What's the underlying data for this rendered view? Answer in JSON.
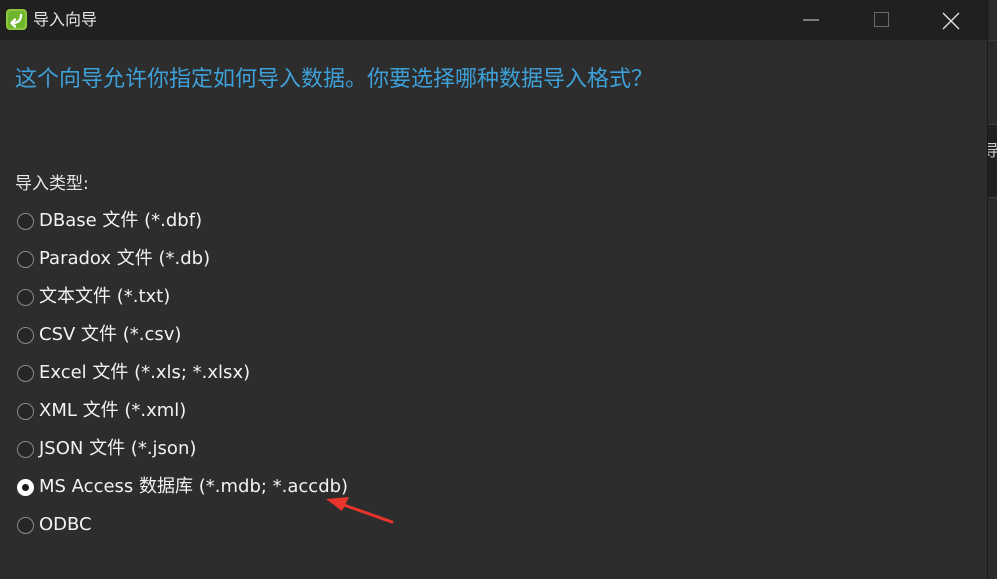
{
  "window": {
    "title": "导入向导",
    "app_icon": "import-wizard-icon",
    "controls": {
      "minimize_icon": "minimize-icon",
      "maximize_icon": "maximize-icon",
      "close_icon": "close-icon"
    }
  },
  "heading": "这个向导允许你指定如何导入数据。你要选择哪种数据导入格式？",
  "import_type": {
    "label": "导入类型:",
    "options": [
      {
        "label": "DBase 文件 (*.dbf)",
        "checked": false
      },
      {
        "label": "Paradox 文件 (*.db)",
        "checked": false
      },
      {
        "label": "文本文件 (*.txt)",
        "checked": false
      },
      {
        "label": "CSV 文件 (*.csv)",
        "checked": false
      },
      {
        "label": "Excel 文件 (*.xls; *.xlsx)",
        "checked": false
      },
      {
        "label": "XML 文件 (*.xml)",
        "checked": false
      },
      {
        "label": "JSON 文件 (*.json)",
        "checked": false
      },
      {
        "label": "MS Access 数据库 (*.mdb; *.accdb)",
        "checked": true
      },
      {
        "label": "ODBC",
        "checked": false
      }
    ]
  },
  "background_window": {
    "partial_text": "导入"
  },
  "colors": {
    "heading": "#3ea0d8",
    "annotation_arrow": "#e8352b",
    "window_bg": "#2d2d2d",
    "titlebar_bg": "#202020"
  }
}
